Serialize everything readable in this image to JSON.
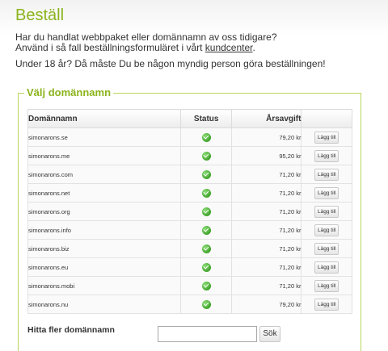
{
  "page": {
    "title": "Beställ",
    "intro_line1": "Har du handlat webbpaket eller domännamn av oss tidigare?",
    "intro_line2_prefix": "Använd i så fall beställningsformuläret i vårt ",
    "intro_link": "kundcenter",
    "intro_line2_suffix": ".",
    "age_note": "Under 18 år? Då måste Du be någon myndig person göra beställningen!"
  },
  "domain_section": {
    "legend": "Välj domännamn",
    "columns": {
      "domain": "Domännamn",
      "status": "Status",
      "fee": "Årsavgift",
      "action": ""
    },
    "rows": [
      {
        "domain": "simonarons.se",
        "status_icon": "checkmark-icon",
        "fee": "79,20 kr",
        "button": "Lägg till"
      },
      {
        "domain": "simonarons.me",
        "status_icon": "checkmark-icon",
        "fee": "95,20 kr",
        "button": "Lägg till"
      },
      {
        "domain": "simonarons.com",
        "status_icon": "checkmark-icon",
        "fee": "71,20 kr",
        "button": "Lägg till"
      },
      {
        "domain": "simonarons.net",
        "status_icon": "checkmark-icon",
        "fee": "71,20 kr",
        "button": "Lägg till"
      },
      {
        "domain": "simonarons.org",
        "status_icon": "checkmark-icon",
        "fee": "71,20 kr",
        "button": "Lägg till"
      },
      {
        "domain": "simonarons.info",
        "status_icon": "checkmark-icon",
        "fee": "71,20 kr",
        "button": "Lägg till"
      },
      {
        "domain": "simonarons.biz",
        "status_icon": "checkmark-icon",
        "fee": "71,20 kr",
        "button": "Lägg till"
      },
      {
        "domain": "simonarons.eu",
        "status_icon": "checkmark-icon",
        "fee": "71,20 kr",
        "button": "Lägg till"
      },
      {
        "domain": "simonarons.mobi",
        "status_icon": "checkmark-icon",
        "fee": "71,20 kr",
        "button": "Lägg till"
      },
      {
        "domain": "simonarons.nu",
        "status_icon": "checkmark-icon",
        "fee": "79,20 kr",
        "button": "Lägg till"
      }
    ]
  },
  "search": {
    "label": "Hitta fler domännamn",
    "value": "",
    "placeholder": "",
    "button": "Sök"
  },
  "colors": {
    "accent": "#8bb41c",
    "border_accent": "#b8d65a",
    "ok": "#3fa22a"
  }
}
